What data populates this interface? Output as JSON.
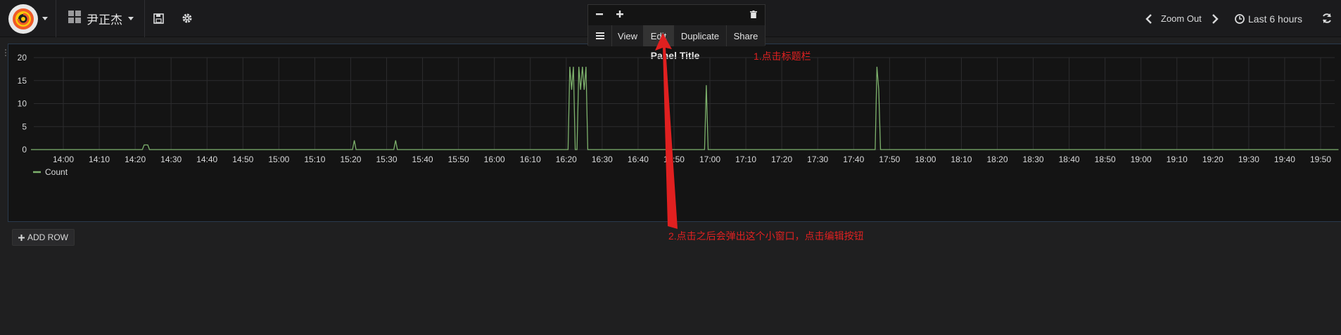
{
  "navbar": {
    "dashboard_title": "尹正杰",
    "zoom_out_label": "Zoom Out",
    "time_range_label": "Last 6 hours"
  },
  "panel_menu": {
    "view_label": "View",
    "edit_label": "Edit",
    "duplicate_label": "Duplicate",
    "share_label": "Share"
  },
  "panel": {
    "title": "Panel Title"
  },
  "annotations": {
    "step1": "1.点击标题栏",
    "step2": "2.点击之后会弹出这个小窗口，点击编辑按钮"
  },
  "add_row_label": "ADD ROW",
  "colors": {
    "series": "#7eb26d",
    "annotation": "#e02020",
    "grafana_orange": "#f05a28"
  },
  "chart_data": {
    "type": "line",
    "title": "Panel Title",
    "ylim": [
      0,
      20
    ],
    "yticks": [
      "0",
      "5",
      "10",
      "15",
      "20"
    ],
    "xticks": [
      "14:00",
      "14:10",
      "14:20",
      "14:30",
      "14:40",
      "14:50",
      "15:00",
      "15:10",
      "15:20",
      "15:30",
      "15:40",
      "15:50",
      "16:00",
      "16:10",
      "16:20",
      "16:30",
      "16:40",
      "16:50",
      "17:00",
      "17:10",
      "17:20",
      "17:30",
      "17:40",
      "17:50",
      "18:00",
      "18:10",
      "18:20",
      "18:30",
      "18:40",
      "18:50",
      "19:00",
      "19:10",
      "19:20",
      "19:30",
      "19:40",
      "19:50"
    ],
    "grid": true,
    "legend_position": "bottom-left",
    "series": [
      {
        "name": "Count",
        "color": "#7eb26d",
        "x": [
          "13:51",
          "14:22",
          "14:22.5",
          "14:23",
          "14:23.5",
          "14:24",
          "15:20.5",
          "15:21",
          "15:21.5",
          "15:32",
          "15:32.5",
          "15:33",
          "16:20.5",
          "16:21",
          "16:21.5",
          "16:22",
          "16:22.5",
          "16:23",
          "16:23.5",
          "16:24",
          "16:24.5",
          "16:25",
          "16:25.5",
          "16:26",
          "16:26.5",
          "16:27",
          "16:58.5",
          "16:59",
          "16:59.5",
          "17:46",
          "17:46.5",
          "17:47",
          "17:47.5",
          "19:55"
        ],
        "y": [
          0,
          0,
          1,
          1,
          1,
          0,
          0,
          2,
          0,
          0,
          2,
          0,
          0,
          18,
          13,
          18,
          0,
          0,
          18,
          13,
          18,
          13,
          18,
          0,
          0,
          0,
          0,
          14,
          0,
          0,
          18,
          13,
          0,
          0
        ]
      }
    ]
  }
}
